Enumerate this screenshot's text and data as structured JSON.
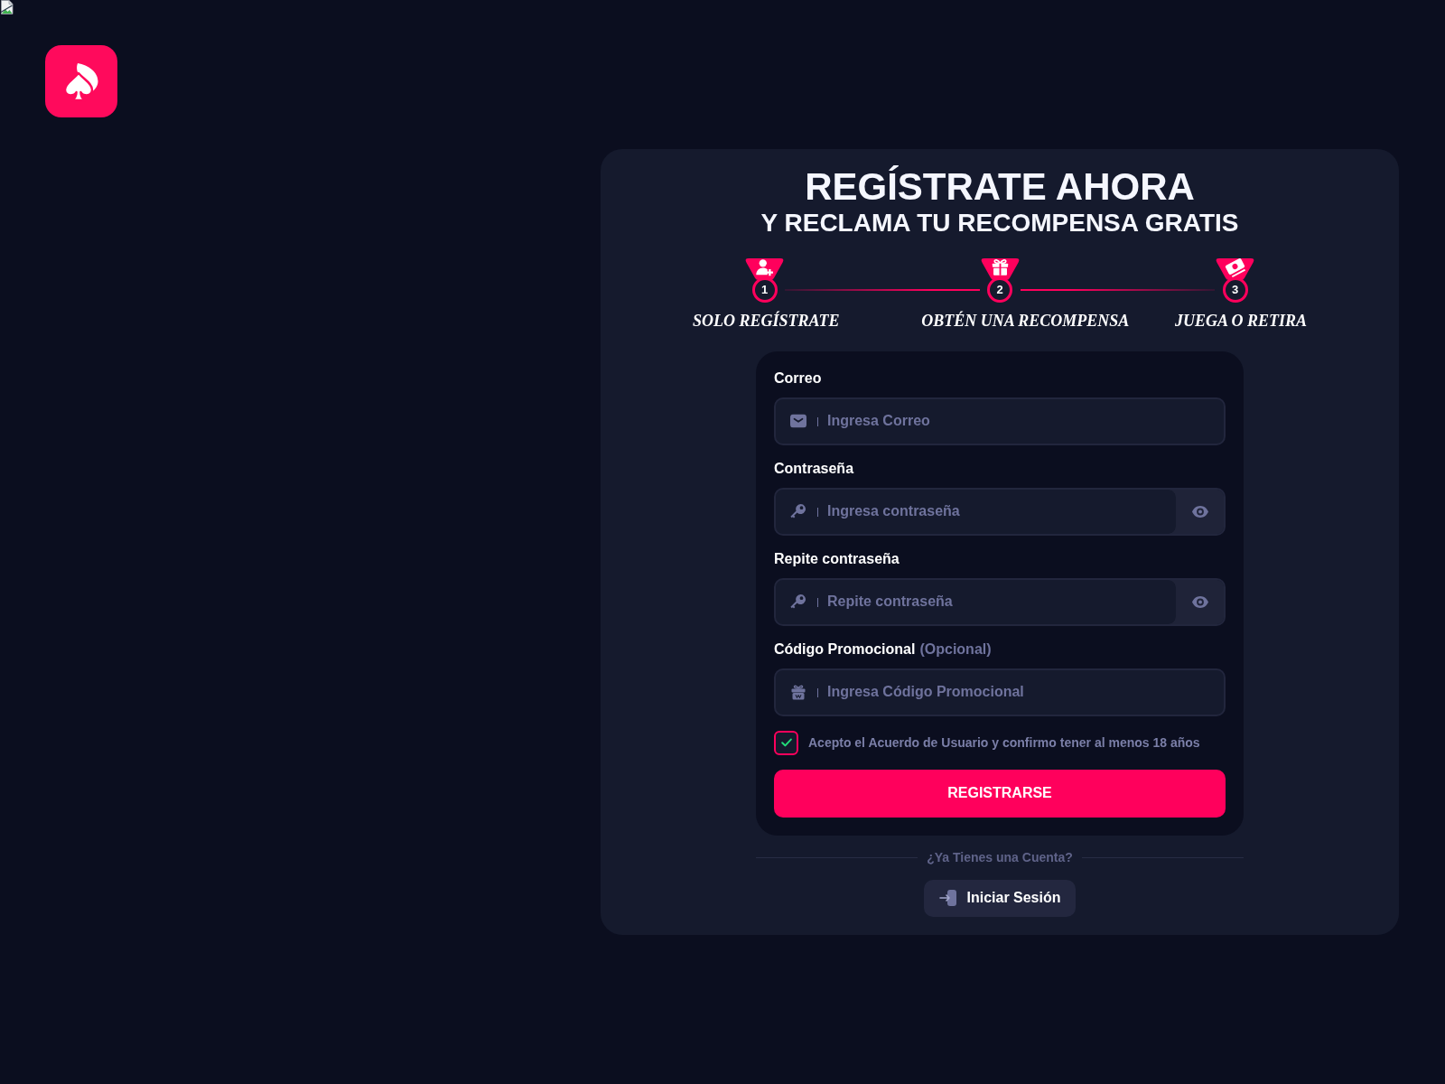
{
  "heading": {
    "title": "REGÍSTRATE AHORA",
    "subtitle": "Y RECLAMA TU RECOMPENSA GRATIS"
  },
  "steps": [
    {
      "kind": "register",
      "number": "1",
      "label": "SOLO REGÍSTRATE"
    },
    {
      "kind": "reward",
      "number": "2",
      "label": "OBTÉN UNA RECOMPENSA"
    },
    {
      "kind": "play",
      "number": "3",
      "label": "JUEGA O RETIRA"
    }
  ],
  "form": {
    "fields": [
      {
        "kind": "email",
        "label": "Correo",
        "placeholder": "Ingresa Correo"
      },
      {
        "kind": "password",
        "label": "Contraseña",
        "placeholder": "Ingresa contraseña"
      },
      {
        "kind": "password",
        "label": "Repite contraseña",
        "placeholder": "Repite contraseña"
      },
      {
        "kind": "promo",
        "label": "Código Promocional",
        "note": "(Opcional)",
        "placeholder": "Ingresa Código Promocional"
      }
    ],
    "agreement": {
      "text": "Acepto el Acuerdo de Usuario y confirmo tener al menos 18 años",
      "checked": true
    },
    "submit": "REGISTRARSE"
  },
  "login": {
    "prompt": "¿Ya Tienes una Cuenta?",
    "button": "Iniciar Sesión"
  }
}
